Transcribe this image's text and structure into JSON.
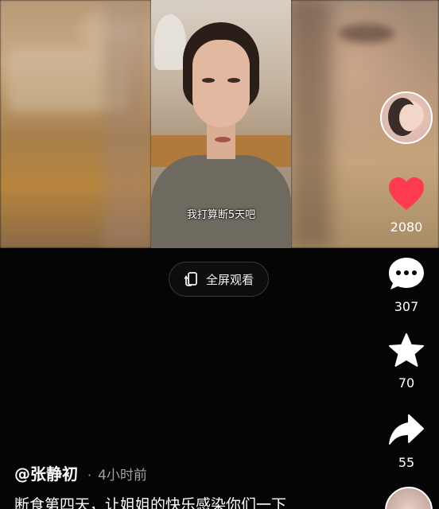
{
  "video": {
    "caption": "我打算断5天吧"
  },
  "fullscreen_button": {
    "label": "全屏观看",
    "icon": "fullscreen-rotate-icon"
  },
  "rail": {
    "like": {
      "icon": "heart-icon",
      "count": "2080",
      "color": "#ff3b4f"
    },
    "comment": {
      "icon": "comment-icon",
      "count": "307"
    },
    "favorite": {
      "icon": "star-icon",
      "count": "70"
    },
    "share": {
      "icon": "share-icon",
      "count": "55"
    }
  },
  "post": {
    "author": "@张静初",
    "separator": "·",
    "time": "4小时前",
    "description": "断食第四天，让姐姐的快乐感染你们一下"
  }
}
